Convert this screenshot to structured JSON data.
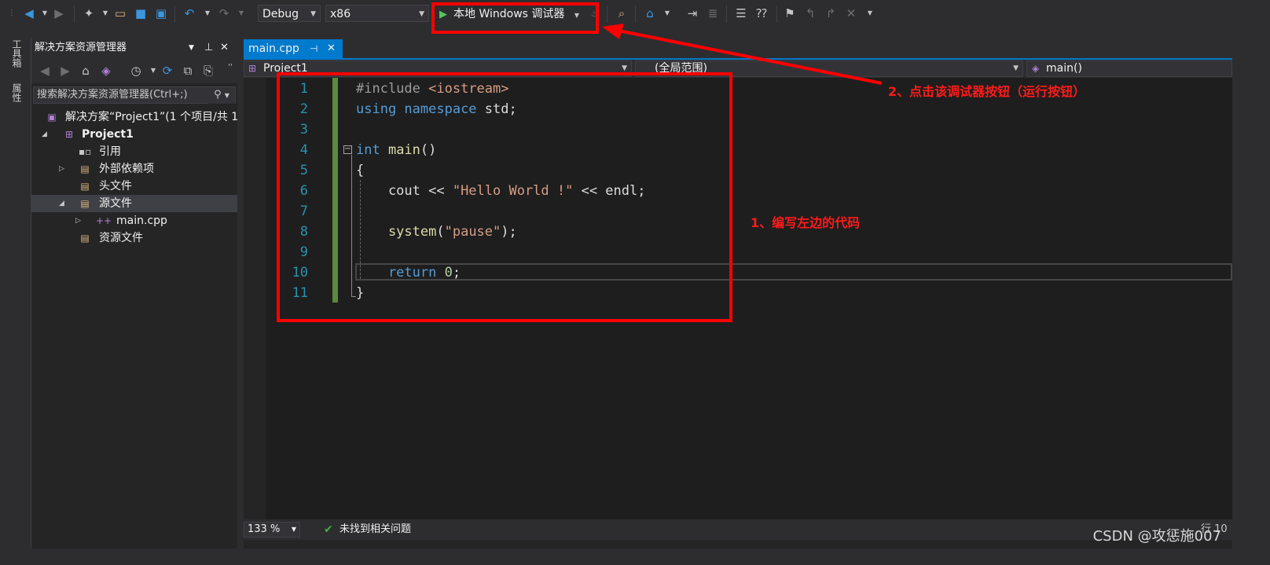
{
  "toolbar": {
    "config": "Debug",
    "platform": "x86",
    "run_label": "本地 Windows 调试器"
  },
  "side_tabs": {
    "toolbox": "工具箱",
    "properties": "属性"
  },
  "solution_explorer": {
    "title": "解决方案资源管理器",
    "search_placeholder": "搜索解决方案资源管理器(Ctrl+;)",
    "tree": [
      {
        "label": "解决方案“Project1”(1 个项目/共 1"
      },
      {
        "label": "Project1"
      },
      {
        "label": "引用"
      },
      {
        "label": "外部依赖项"
      },
      {
        "label": "头文件"
      },
      {
        "label": "源文件"
      },
      {
        "label": "main.cpp"
      },
      {
        "label": "资源文件"
      }
    ]
  },
  "editor": {
    "tab_label": "main.cpp",
    "nav": {
      "project": "Project1",
      "scope": "(全局范围)",
      "member": "main()"
    },
    "line_numbers": [
      "1",
      "2",
      "3",
      "4",
      "5",
      "6",
      "7",
      "8",
      "9",
      "10",
      "11"
    ],
    "lines": {
      "l1": {
        "kw": "#include",
        "str": " <iostream>"
      },
      "l2": {
        "kw1": "using",
        "kw2": " namespace",
        "rest": " std;"
      },
      "l4": {
        "kw": "int",
        "fn": " main",
        "rest": "()"
      },
      "l5": "{",
      "l6": {
        "pre": "    cout << ",
        "str": "\"Hello World !\"",
        "post": " << endl;"
      },
      "l8": {
        "fn": "    system",
        "p1": "(",
        "str": "\"pause\"",
        "p2": ");"
      },
      "l10": {
        "kw": "    return",
        "num": " 0",
        "rest": ";"
      },
      "l11": "}"
    }
  },
  "status_bar": {
    "zoom": "133 %",
    "issues": "未找到相关问题",
    "line": "行 10"
  },
  "annotations": {
    "a1": "1、编写左边的代码",
    "a2": "2、点击该调试器按钮（运行按钮）"
  },
  "watermark": "CSDN @攻惩施007",
  "colors": {
    "accent": "#007acc",
    "annotation": "#ff0000",
    "keyword": "#569cd6",
    "string": "#d69d85",
    "number": "#b5cea8",
    "function": "#dcdcaa"
  }
}
